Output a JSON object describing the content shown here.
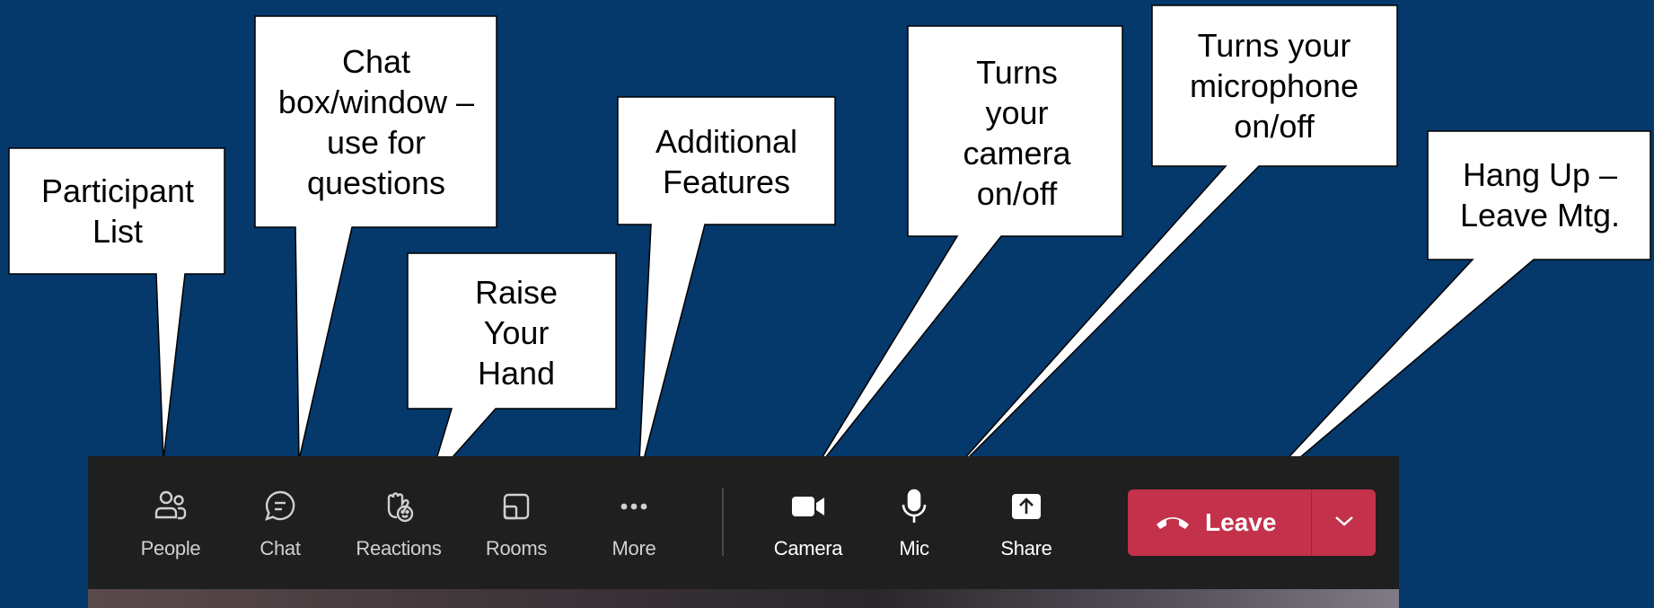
{
  "callouts": {
    "participant_list": "Participant List",
    "chat_box": "Chat box/window – use for questions",
    "raise_hand": "Raise Your Hand",
    "additional_features": "Additional Features",
    "camera": "Turns your camera on/off",
    "microphone": "Turns your microphone on/off",
    "hang_up": "Hang Up – Leave Mtg."
  },
  "toolbar": {
    "people_label": "People",
    "chat_label": "Chat",
    "reactions_label": "Reactions",
    "rooms_label": "Rooms",
    "more_label": "More",
    "camera_label": "Camera",
    "mic_label": "Mic",
    "share_label": "Share",
    "leave_label": "Leave"
  },
  "icons": {
    "people": "people-icon",
    "chat": "chat-icon",
    "reactions": "raise-hand-icon",
    "rooms": "rooms-icon",
    "more": "more-icon",
    "camera": "camera-icon",
    "mic": "mic-icon",
    "share": "share-icon",
    "leave": "phone-hangup-icon",
    "dropdown": "chevron-down-icon"
  },
  "colors": {
    "background": "#05386b",
    "toolbar": "#1f1f1f",
    "leave_button": "#c4314b",
    "callout_fill": "#ffffff"
  }
}
